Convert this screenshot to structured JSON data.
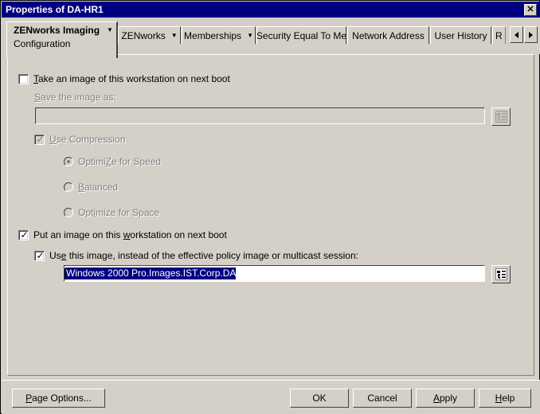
{
  "window": {
    "title": "Properties of DA-HR1",
    "close_label": "✕"
  },
  "tabs": {
    "active": {
      "line1": "ZENworks Imaging",
      "line2": "Configuration",
      "caret": "▼"
    },
    "items": [
      {
        "label": "ZENworks",
        "caret": "▼",
        "has_caret": true
      },
      {
        "label": "Memberships",
        "caret": "▼",
        "has_caret": true
      },
      {
        "label": "Security Equal To Me",
        "has_caret": false
      },
      {
        "label": "Network Address",
        "has_caret": false
      },
      {
        "label": "User History",
        "has_caret": false
      },
      {
        "label": "R",
        "has_caret": false
      }
    ],
    "scroll_left": "◀",
    "scroll_right": "▶"
  },
  "form": {
    "take_image_checkbox": {
      "label_pre": "",
      "label_accel": "T",
      "label_post": "ake an image of this workstation on next boot",
      "checked": false,
      "enabled": true
    },
    "save_image_label": {
      "accel": "S",
      "post": "ave the image as:",
      "enabled": false
    },
    "save_image_input": {
      "value": "",
      "enabled": false
    },
    "use_compression_checkbox": {
      "accel": "U",
      "post": "se Compression",
      "checked": true,
      "enabled": false
    },
    "compression_options": [
      {
        "accel": "Z",
        "pre": "Optimi",
        "post": "e for Speed",
        "selected": true
      },
      {
        "accel": "B",
        "pre": "",
        "post": "alanced",
        "selected": false
      },
      {
        "accel": "i",
        "pre": "Opt",
        "post": "mize for Space",
        "selected": false
      }
    ],
    "put_image_checkbox": {
      "pre": "Put an image on this ",
      "accel": "w",
      "post": "orkstation on next boot",
      "checked": true,
      "enabled": true
    },
    "use_this_image_checkbox": {
      "pre": "Us",
      "accel": "e",
      "post": " this image, instead of the effective policy image or multicast session:",
      "checked": true,
      "enabled": true
    },
    "image_path_input": {
      "value": "Windows 2000 Pro.Images.IST.Corp.DA",
      "selected": true,
      "enabled": true
    },
    "browse_icon_name": "tree-browse-icon"
  },
  "buttons": {
    "page_options": {
      "accel": "P",
      "post": "age Options..."
    },
    "ok": {
      "label": "OK"
    },
    "cancel": {
      "label": "Cancel"
    },
    "apply": {
      "accel": "A",
      "post": "pply"
    },
    "help": {
      "accel": "H",
      "post": "elp"
    }
  },
  "colors": {
    "titlebar": "#000080",
    "face": "#d4d0c8",
    "selection": "#000080",
    "disabled_text": "#808080"
  }
}
